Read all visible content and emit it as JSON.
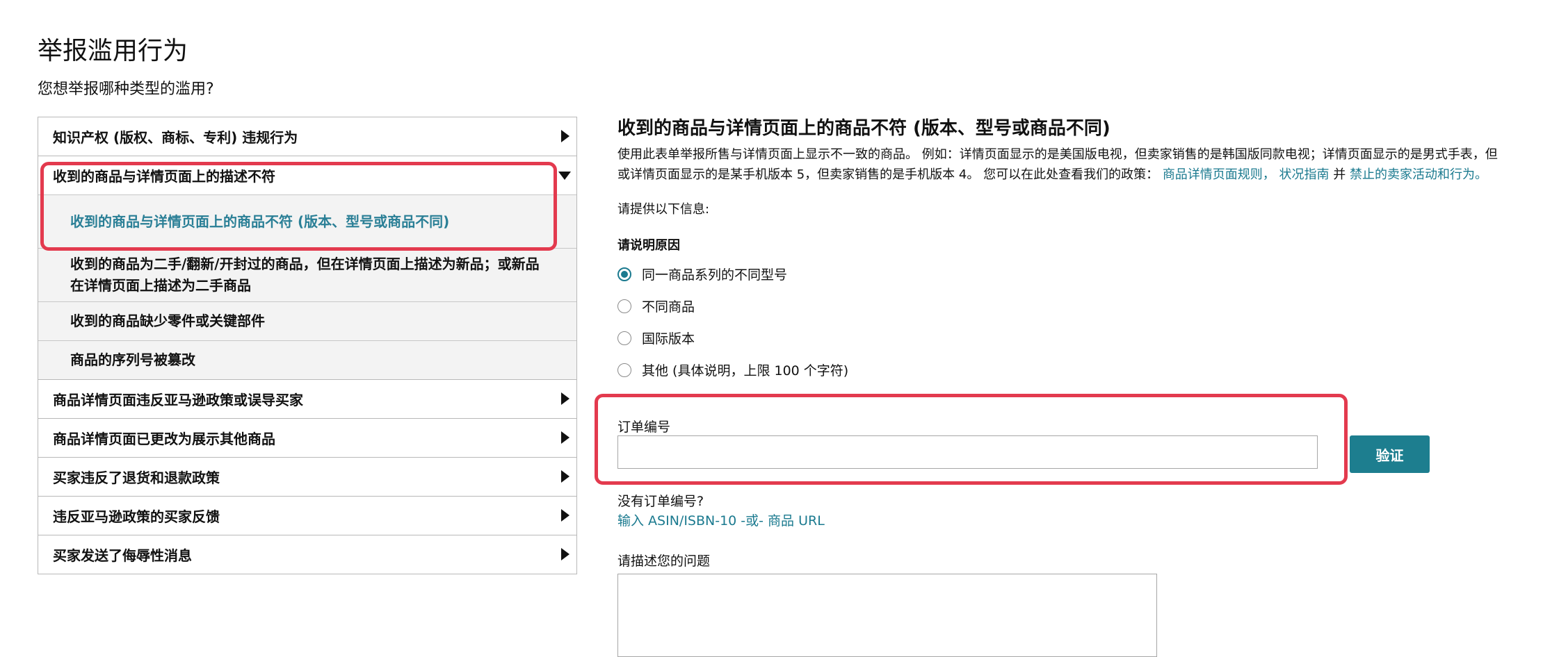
{
  "page": {
    "title": "举报滥用行为",
    "question": "您想举报哪种类型的滥用?"
  },
  "categories": [
    {
      "label": "知识产权 (版权、商标、专利) 违规行为",
      "expanded": false
    },
    {
      "label": "收到的商品与详情页面上的描述不符",
      "expanded": true,
      "subitems": [
        {
          "label": "收到的商品与详情页面上的商品不符 (版本、型号或商品不同)",
          "selected": true
        },
        {
          "label_line1": "收到的商品为二手/翻新/开封过的商品，但在详情页面上描述为新品；或新品",
          "label_line2": "在详情页面上描述为二手商品",
          "selected": false
        },
        {
          "label": "收到的商品缺少零件或关键部件",
          "selected": false
        },
        {
          "label": "商品的序列号被篡改",
          "selected": false
        }
      ]
    },
    {
      "label": "商品详情页面违反亚马逊政策或误导买家",
      "expanded": false
    },
    {
      "label": "商品详情页面已更改为展示其他商品",
      "expanded": false
    },
    {
      "label": "买家违反了退货和退款政策",
      "expanded": false
    },
    {
      "label": "违反亚马逊政策的买家反馈",
      "expanded": false
    },
    {
      "label": "买家发送了侮辱性消息",
      "expanded": false
    }
  ],
  "form": {
    "title": "收到的商品与详情页面上的商品不符 (版本、型号或商品不同)",
    "desc_line1": "使用此表单举报所售与详情页面上显示不一致的商品。 例如：详情页面显示的是美国版电视，但卖家销售的是韩国版同款电视；详情页面显示的是男式手表，但",
    "desc_line2_prefix": "或详情页面显示的是某手机版本 5，但卖家销售的是手机版本 4。 您可以在此处查看我们的政策：",
    "link_listing_rules": "商品详情页面规则，",
    "link_condition_guide": "状况指南",
    "desc_and": "并",
    "link_prohibited": "禁止的卖家活动和行为。",
    "prompt": "请提供以下信息:",
    "reason_label": "请说明原因",
    "reasons": [
      {
        "label": "同一商品系列的不同型号",
        "checked": true
      },
      {
        "label": "不同商品",
        "checked": false
      },
      {
        "label": "国际版本",
        "checked": false
      },
      {
        "label": "其他 (具体说明，上限 100 个字符)",
        "checked": false
      }
    ],
    "order_label": "订单编号",
    "order_value": "",
    "verify_button": "验证",
    "no_order_text": "没有订单编号?",
    "asin_link": "输入 ASIN/ISBN-10 -或- 商品 URL",
    "describe_label": "请描述您的问题",
    "describe_value": ""
  },
  "colors": {
    "accent": "#1b7a8f",
    "button": "#1d7e8f",
    "highlight": "#e33a4e",
    "subitem_bg": "#f3f3f3"
  },
  "icons": {
    "collapsed": "caret-right-icon",
    "expanded": "caret-down-icon"
  }
}
